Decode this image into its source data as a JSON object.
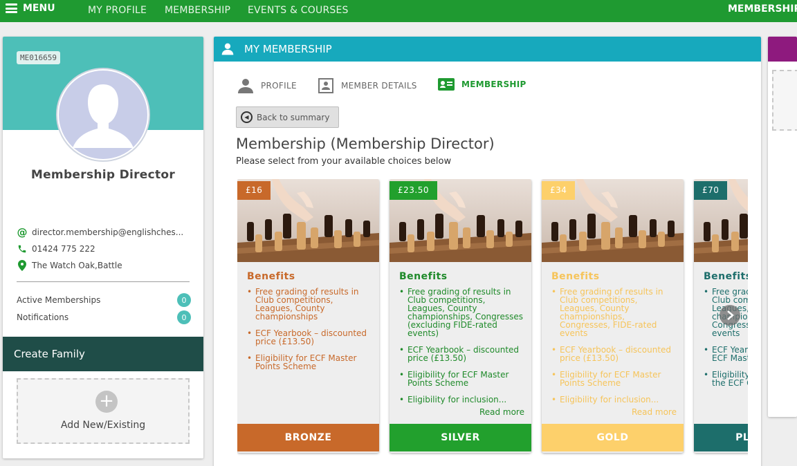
{
  "topnav": {
    "menu_label": "MENU",
    "links": [
      "MY PROFILE",
      "MEMBERSHIP",
      "EVENTS & COURSES"
    ],
    "right_label": "MEMBERSHIP"
  },
  "profile": {
    "member_id": "ME016659",
    "name": "Membership Director",
    "email": "director.membership@englishches...",
    "phone": "01424 775 222",
    "location": "The Watch Oak,Battle",
    "stats": [
      {
        "label": "Active Memberships",
        "count": "0"
      },
      {
        "label": "Notifications",
        "count": "0"
      }
    ],
    "family": {
      "title": "Create Family",
      "add_label": "Add New/Existing"
    }
  },
  "main": {
    "header": "MY MEMBERSHIP",
    "tabs": [
      {
        "label": "PROFILE",
        "icon": "person-icon"
      },
      {
        "label": "MEMBER DETAILS",
        "icon": "contact-card-icon"
      },
      {
        "label": "MEMBERSHIP",
        "icon": "id-card-icon"
      }
    ],
    "back_label": "Back to summary",
    "title": "Membership (Membership Director)",
    "subtitle": "Please select from your available choices below",
    "cards": [
      {
        "price": "£16",
        "heading": "Benefits",
        "benefits": [
          "Free grading of results in Club competitions, Leagues, County championships",
          "ECF Yearbook – discounted price (£13.50)",
          "Eligibility for ECF Master Points Scheme"
        ],
        "read_more": "",
        "tier": "BRONZE",
        "color": "#c8692a",
        "text_color": "#c8692a"
      },
      {
        "price": "£23.50",
        "heading": "Benefits",
        "benefits": [
          "Free grading of results in Club competitions, Leagues, County championships, Congresses (excluding FIDE-rated events)",
          "ECF Yearbook – discounted price (£13.50)",
          "Eligibility for ECF Master Points Scheme",
          "Eligibility for inclusion..."
        ],
        "read_more": "Read more",
        "tier": "SILVER",
        "color": "#22a02d",
        "text_color": "#1f8a2a"
      },
      {
        "price": "£34",
        "heading": "Benefits",
        "benefits": [
          "Free grading of results in Club competitions, Leagues, County championships, Congresses, FIDE-rated events",
          "ECF Yearbook – discounted price (£13.50)",
          "Eligibility for ECF Master Points Scheme",
          "Eligibility for inclusion..."
        ],
        "read_more": "Read more",
        "tier": "GOLD",
        "color": "#fdd06b",
        "text_color": "#f6c45a"
      },
      {
        "price": "£70",
        "heading": "Benefits",
        "benefits": [
          "Free grading of results in Club competitions, Leagues, County championships, Congresses, FIDE-rated events",
          "ECF Yearbook Eligibility for ECF Master Points Scheme",
          "Eligibility for inclusion in the ECF Grading List"
        ],
        "read_more": "",
        "tier": "PLATINUM",
        "color": "#1d6e6b",
        "text_color": "#1d6e6b"
      }
    ]
  },
  "colors": {
    "nav_green": "#1f9a31",
    "teal": "#4dbfb8",
    "header_cyan": "#17a9bd",
    "family_dark": "#1f4d48",
    "right_purple": "#8e1a7e"
  }
}
